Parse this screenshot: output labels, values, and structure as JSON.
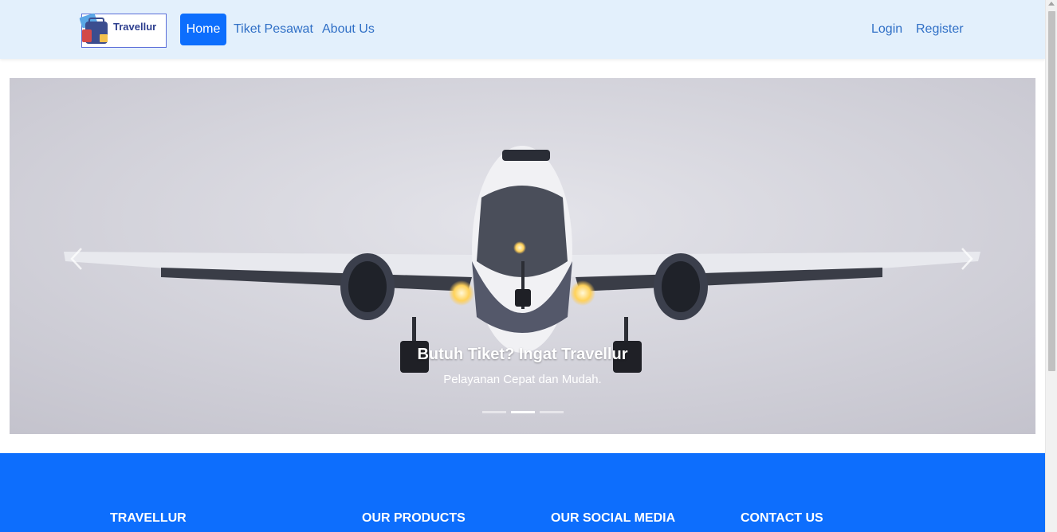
{
  "brand": {
    "name": "Travellur"
  },
  "nav": {
    "home": "Home",
    "tiket_pesawat": "Tiket Pesawat",
    "about_us": "About Us",
    "login": "Login",
    "register": "Register"
  },
  "carousel": {
    "caption_title": "Butuh Tiket? Ingat Travellur",
    "caption_subtitle": "Pelayanan Cepat dan Mudah.",
    "slide_count": 3,
    "active_slide": 2,
    "prev_icon": "chevron-left-icon",
    "next_icon": "chevron-right-icon"
  },
  "footer": {
    "col1": "TRAVELLUR",
    "col2": "OUR PRODUCTS",
    "col3": "OUR SOCIAL MEDIA",
    "col4": "CONTACT US"
  },
  "colors": {
    "primary": "#0d6efd",
    "navbar_bg": "#e3f0fc",
    "nav_link": "#2f6fc6"
  }
}
